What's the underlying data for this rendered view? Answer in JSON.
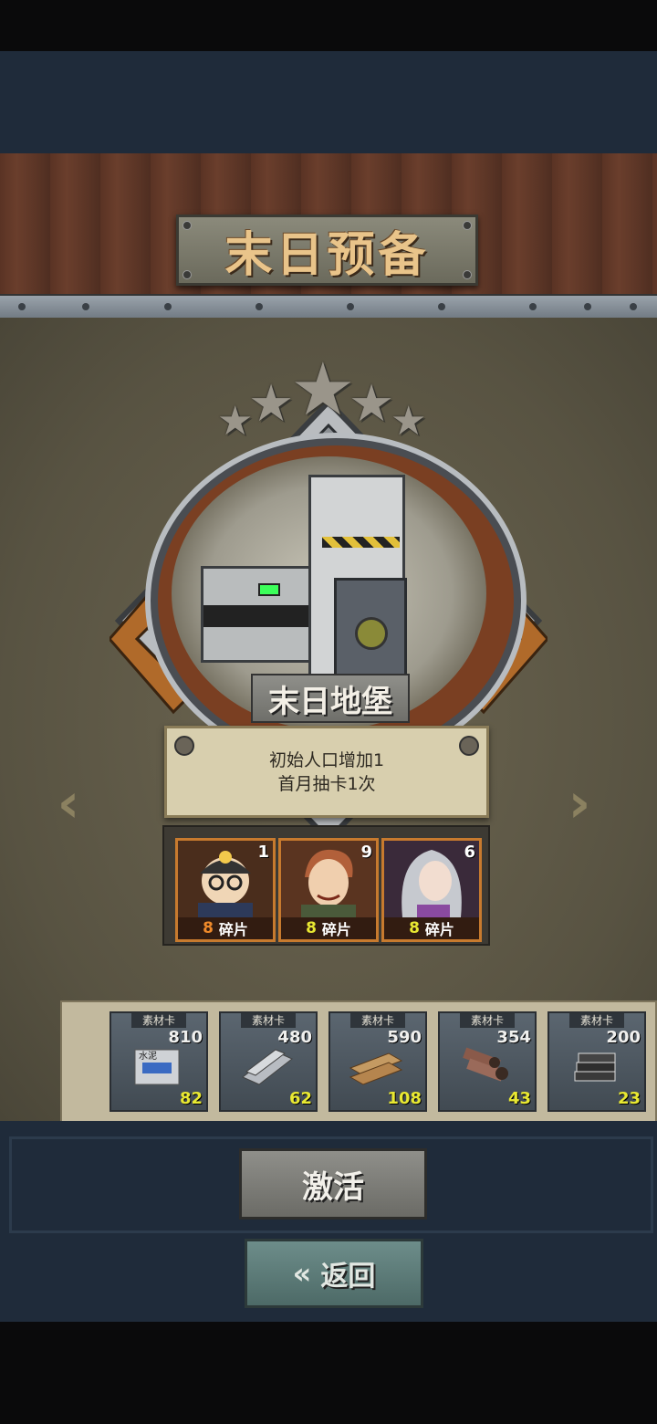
{
  "header": {
    "title": "末日预备"
  },
  "emblem": {
    "name": "末日地堡",
    "stars": 5,
    "desc_line1": "初始人口增加1",
    "desc_line2": "首月抽卡1次"
  },
  "characters": [
    {
      "count": "1",
      "fragments": "8",
      "fragment_color": "#f08a2a",
      "label": "碎片"
    },
    {
      "count": "9",
      "fragments": "8",
      "fragment_color": "#e8e832",
      "label": "碎片"
    },
    {
      "count": "6",
      "fragments": "8",
      "fragment_color": "#e8e832",
      "label": "碎片"
    }
  ],
  "materials": [
    {
      "tag": "素材卡",
      "total": "810",
      "have": "82",
      "icon": "cement-icon",
      "icon_text": "水泥"
    },
    {
      "tag": "素材卡",
      "total": "480",
      "have": "62",
      "icon": "steel-plate-icon"
    },
    {
      "tag": "素材卡",
      "total": "590",
      "have": "108",
      "icon": "wood-plank-icon"
    },
    {
      "tag": "素材卡",
      "total": "354",
      "have": "43",
      "icon": "pipe-icon"
    },
    {
      "tag": "素材卡",
      "total": "200",
      "have": "23",
      "icon": "book-stack-icon"
    }
  ],
  "buttons": {
    "activate": "激活",
    "back": "返回"
  },
  "nav": {
    "prev_glyph": "‹",
    "next_glyph": "›",
    "back_glyph": "«"
  }
}
